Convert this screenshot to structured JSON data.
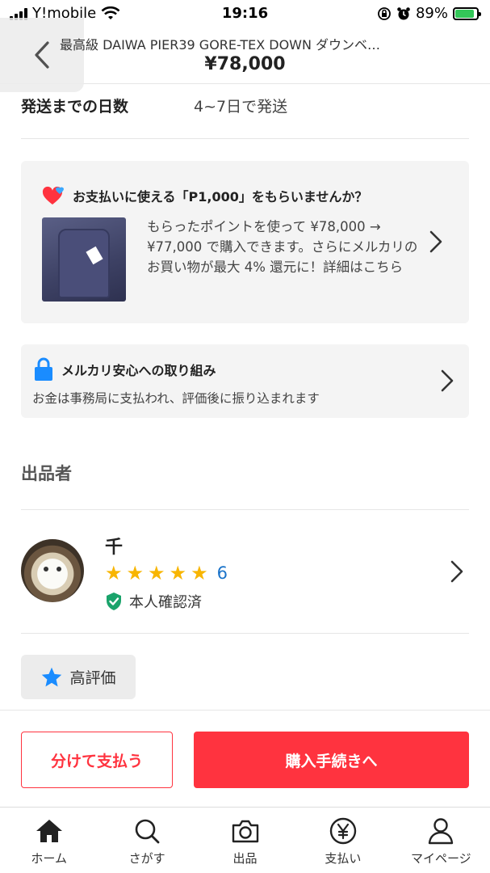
{
  "status_bar": {
    "carrier": "Y!mobile",
    "time": "19:16",
    "battery": "89%"
  },
  "header": {
    "title": "最高級 DAIWA PIER39 GORE-TEX DOWN ダウンベ…",
    "price": "¥78,000"
  },
  "shipping": {
    "label": "発送までの日数",
    "value": "4~7日で発送"
  },
  "point_card": {
    "headline": "お支払いに使える「P1,000」をもらいませんか？",
    "body": "もらったポイントを使って ¥78,000 → ¥77,000 で購入できます。さらにメルカリのお買い物が最大 4% 還元に！詳細はこちら"
  },
  "safety_card": {
    "headline": "メルカリ安心への取り組み",
    "body": "お金は事務局に支払われ、評価後に振り込まれます"
  },
  "seller": {
    "heading": "出品者",
    "name": "千",
    "rating": 5,
    "review_count": "6",
    "verified_label": "本人確認済"
  },
  "badge": {
    "label": "高評価"
  },
  "actions": {
    "split_pay": "分けて支払う",
    "purchase": "購入手続きへ"
  },
  "tabs": [
    {
      "label": "ホーム",
      "icon": "home-icon"
    },
    {
      "label": "さがす",
      "icon": "search-icon"
    },
    {
      "label": "出品",
      "icon": "camera-icon"
    },
    {
      "label": "支払い",
      "icon": "yen-icon"
    },
    {
      "label": "マイページ",
      "icon": "person-icon"
    }
  ],
  "colors": {
    "accent": "#ff333f",
    "star": "#f8b500",
    "link": "#1a73c9",
    "verified": "#1aa36b",
    "lock": "#1a8cff"
  }
}
